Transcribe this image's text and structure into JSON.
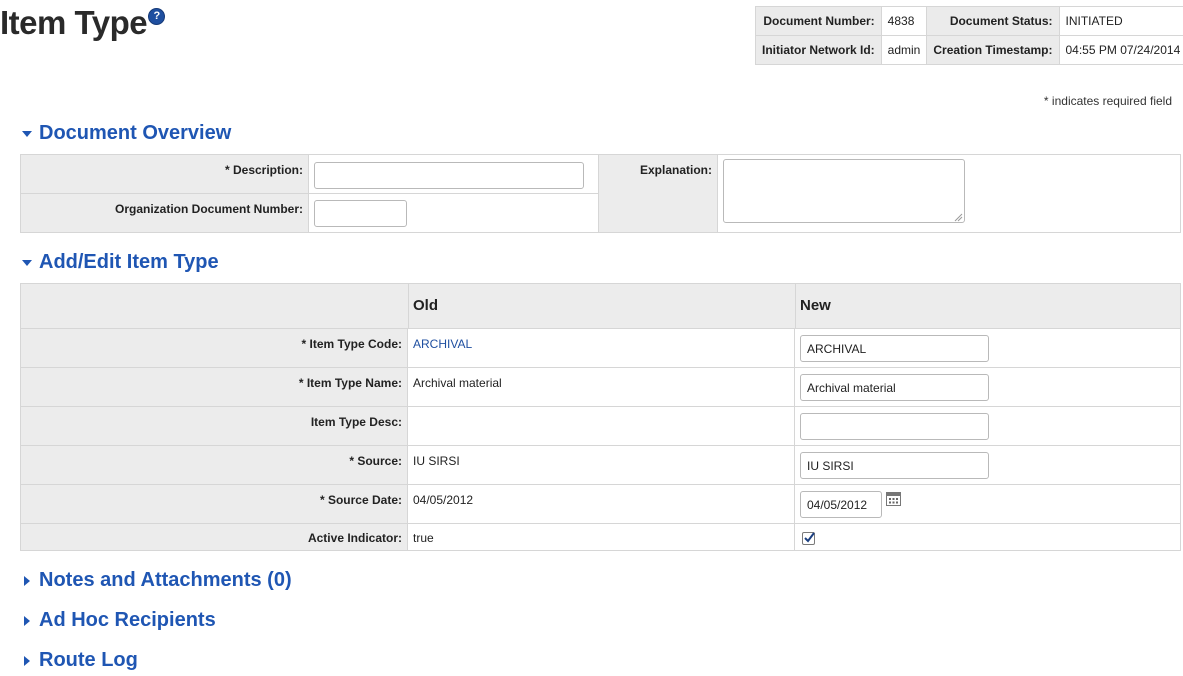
{
  "page": {
    "title": "Item Type",
    "help_glyph": "?",
    "required_note": "* indicates required field"
  },
  "header_info": {
    "document_number_label": "Document Number:",
    "document_number": "4838",
    "document_status_label": "Document Status:",
    "document_status": "INITIATED",
    "initiator_label": "Initiator Network Id:",
    "initiator": "admin",
    "creation_label": "Creation Timestamp:",
    "creation": "04:55 PM 07/24/2014"
  },
  "overview": {
    "title": "Document Overview",
    "description_label": "* Description:",
    "description_value": "",
    "org_doc_label": "Organization Document Number:",
    "org_doc_value": "",
    "explanation_label": "Explanation:",
    "explanation_value": ""
  },
  "edit": {
    "title": "Add/Edit Item Type",
    "old_header": "Old",
    "new_header": "New",
    "rows": [
      {
        "label": "* Item Type Code:",
        "old": "ARCHIVAL",
        "new": "ARCHIVAL"
      },
      {
        "label": "* Item Type Name:",
        "old": "Archival material",
        "new": "Archival material"
      },
      {
        "label": "Item Type Desc:",
        "old": "",
        "new": ""
      },
      {
        "label": "* Source:",
        "old": "IU SIRSI",
        "new": "IU SIRSI"
      },
      {
        "label": "* Source Date:",
        "old": "04/05/2012",
        "new": "04/05/2012"
      },
      {
        "label": "Active Indicator:",
        "old": "true",
        "new": "checked"
      }
    ]
  },
  "collapsed_sections": {
    "notes": "Notes and Attachments (0)",
    "adhoc": "Ad Hoc Recipients",
    "route_log": "Route Log"
  },
  "colors": {
    "accent": "#1f56b3",
    "label_bg": "#ececec",
    "border": "#d6d6d6"
  }
}
